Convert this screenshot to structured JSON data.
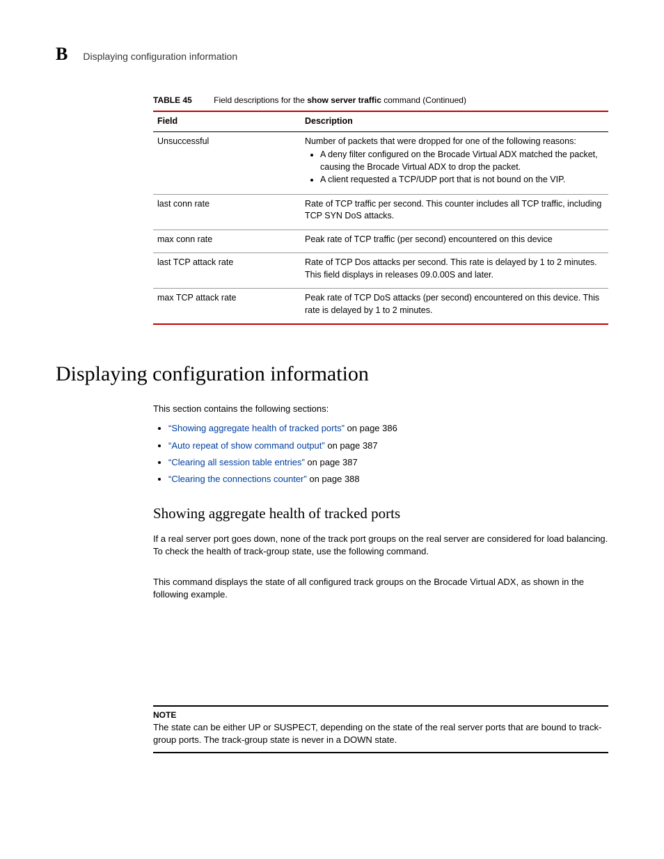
{
  "header": {
    "letter": "B",
    "title": "Displaying configuration information"
  },
  "table": {
    "label": "TABLE 45",
    "caption_pre": "Field descriptions for the ",
    "caption_bold": "show server traffic",
    "caption_post": " command (Continued)",
    "cols": [
      "Field",
      "Description"
    ],
    "rows": [
      {
        "field": "Unsuccessful",
        "desc_intro": "Number of packets that were dropped for one of the following reasons:",
        "desc_items": [
          "A deny filter configured on the Brocade Virtual ADX matched the packet, causing the Brocade Virtual ADX to drop the packet.",
          "A client requested a TCP/UDP port that is not bound on the VIP."
        ]
      },
      {
        "field": "last conn rate",
        "desc": "Rate of TCP traffic per second. This counter includes all TCP traffic, including TCP SYN DoS attacks."
      },
      {
        "field": "max conn rate",
        "desc": "Peak rate of TCP traffic (per second) encountered on this device"
      },
      {
        "field": "last TCP attack rate",
        "desc": "Rate of TCP Dos attacks per second. This rate is delayed by 1 to 2 minutes. This field displays in releases 09.0.00S and later."
      },
      {
        "field": "max TCP attack rate",
        "desc": "Peak rate of TCP DoS attacks (per second) encountered on this device. This rate is delayed by 1 to 2 minutes."
      }
    ]
  },
  "section": {
    "h1": "Displaying configuration information",
    "intro": "This section contains the following sections:",
    "links": [
      {
        "text": "“Showing aggregate health of tracked ports”",
        "suffix": " on page 386"
      },
      {
        "text": "“Auto repeat of show command output”",
        "suffix": " on page 387"
      },
      {
        "text": "“Clearing all session table entries”",
        "suffix": " on page 387"
      },
      {
        "text": "“Clearing the connections counter”",
        "suffix": " on page 388"
      }
    ],
    "h2": "Showing aggregate health of tracked ports",
    "p1": "If a real server port goes down, none of the track port groups on the real server are considered for load balancing. To check the health of track-group state, use the following command.",
    "p2": "This command displays the state of all configured track groups on the Brocade Virtual ADX, as shown in the following example.",
    "note_label": "NOTE",
    "note_text": "The state can be either UP or SUSPECT, depending on the state of the real server ports that are bound to track-group ports. The track-group state is never in a DOWN state."
  }
}
